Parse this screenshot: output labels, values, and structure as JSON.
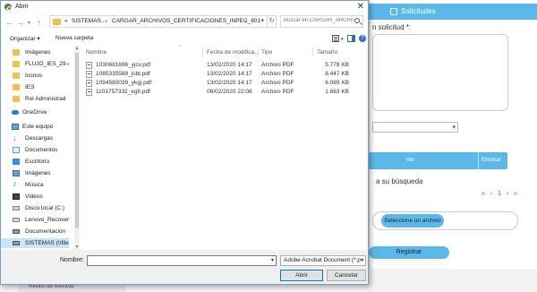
{
  "dialog": {
    "title": "Abrir",
    "breadcrumbs": [
      "«",
      "SISTEMAS...",
      "›",
      "CARGAR_ARCHIVOS_CERTIFICACIONES_INPEC_801",
      "›"
    ],
    "search_placeholder": "Buscar en CARGAR_ARCHIVO...",
    "toolbar": {
      "organize": "Organizar ▾",
      "new_folder": "Nueva carpeta"
    },
    "sidebar": [
      {
        "label": "Imágenes",
        "icon": "folder-icon",
        "type": "sub",
        "pin": "✱"
      },
      {
        "label": "FLUJO_IES_29-AB",
        "icon": "folder-icon",
        "type": "sub"
      },
      {
        "label": "Iconos",
        "icon": "folder-icon",
        "type": "sub"
      },
      {
        "label": "IES",
        "icon": "folder-icon",
        "type": "sub"
      },
      {
        "label": "Rol Administrad",
        "icon": "folder-icon",
        "type": "sub"
      },
      {
        "label": "OneDrive",
        "icon": "cloud-icon",
        "type": "group"
      },
      {
        "label": "Este equipo",
        "icon": "computer-icon",
        "type": "group"
      },
      {
        "label": "Descargas",
        "icon": "download-icon",
        "type": "sub"
      },
      {
        "label": "Documentos",
        "icon": "document-icon",
        "type": "sub"
      },
      {
        "label": "Escritorio",
        "icon": "desktop-icon",
        "type": "sub"
      },
      {
        "label": "Imágenes",
        "icon": "pictures-icon",
        "type": "sub"
      },
      {
        "label": "Música",
        "icon": "music-icon",
        "type": "sub"
      },
      {
        "label": "Videos",
        "icon": "video-icon",
        "type": "sub"
      },
      {
        "label": "Disco local (C:)",
        "icon": "drive-icon",
        "type": "sub"
      },
      {
        "label": "Lenovo_Recover",
        "icon": "drive-icon",
        "type": "sub"
      },
      {
        "label": "Documentacion",
        "icon": "network-drive-icon",
        "type": "sub"
      },
      {
        "label": "SISTEMAS (\\\\file",
        "icon": "network-drive-icon",
        "type": "sub",
        "selected": true
      }
    ],
    "columns": {
      "name": "Nombre",
      "modified": "Fecha de modifica...",
      "type": "Tipo",
      "size": "Tamaño"
    },
    "files": [
      {
        "name": "1030681696_yjcv.pdf",
        "modified": "13/02/2020 14:17",
        "type": "Archivo PDF",
        "size": "5.778 KB"
      },
      {
        "name": "1085335588_jsbt.pdf",
        "modified": "13/02/2020 14:17",
        "type": "Archivo PDF",
        "size": "8.447 KB"
      },
      {
        "name": "1094580039_ykgj.pdf",
        "modified": "13/02/2020 14:17",
        "type": "Archivo PDF",
        "size": "6.089 KB"
      },
      {
        "name": "1101757332_egfr.pdf",
        "modified": "06/02/2020 22:08",
        "type": "Archivo PDF",
        "size": "1.663 KB"
      }
    ],
    "footer": {
      "name_label": "Nombre:",
      "name_value": "",
      "file_type": "Adobe Acrobat Document (*.pd",
      "open_label": "Abrir",
      "cancel_label": "Cancelar"
    }
  },
  "background": {
    "header_title": "Solicitudes",
    "request_label": "n solicitud *:",
    "table_bar": {
      "view": "Ver",
      "delete": "Eliminar"
    },
    "search_text": "a su búsqueda",
    "pager": "« ‹ 1 › »",
    "file_button": "Seleccione un archivo",
    "register_button": "Registrar",
    "bottom_tab": "Recibo de solicitud"
  },
  "colors": {
    "accent": "#5bb8e8",
    "selection": "#cce4f7",
    "folder": "#f0c050"
  }
}
